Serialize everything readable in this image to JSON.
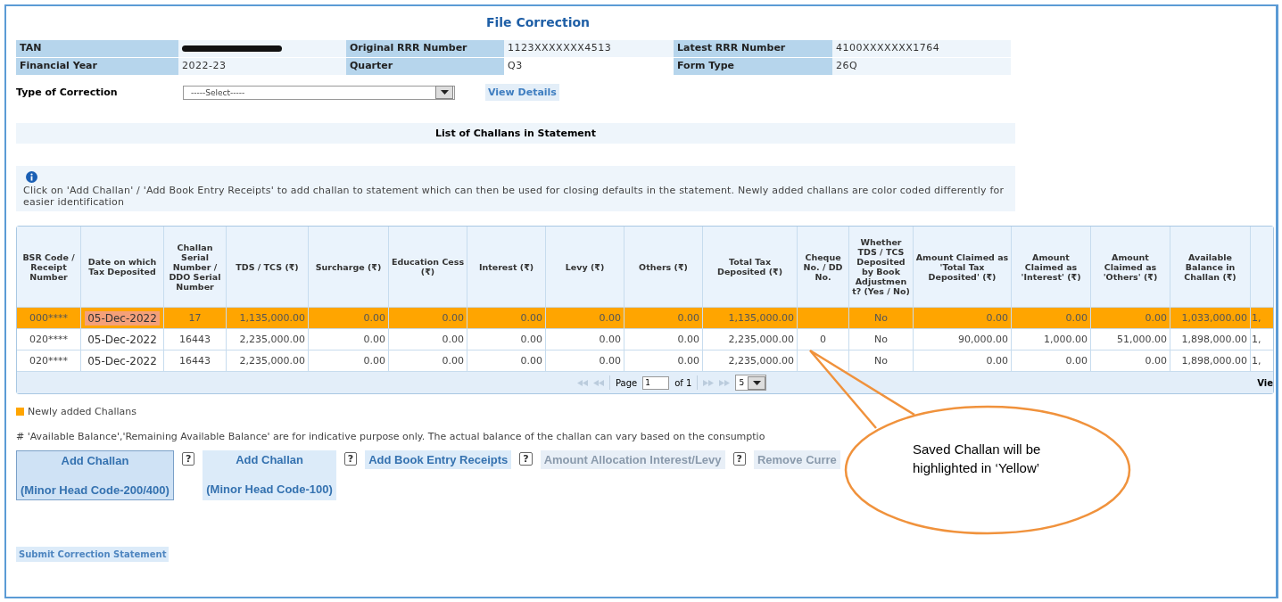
{
  "title": "File Correction",
  "info": [
    {
      "label": "TAN",
      "redacted": true
    },
    {
      "label": "Original RRR Number",
      "value": "1123XXXXXXX4513"
    },
    {
      "label": "Latest RRR Number",
      "value": "4100XXXXXXX1764"
    },
    {
      "label": "Financial Year",
      "value": "2022-23"
    },
    {
      "label": "Quarter",
      "value": "Q3"
    },
    {
      "label": "Form Type",
      "value": "26Q"
    }
  ],
  "correction": {
    "label": "Type of Correction",
    "placeholder": "-----Select-----",
    "button": "View Details"
  },
  "list_heading": "List of Challans in Statement",
  "info_text": "Click on 'Add Challan' / 'Add Book Entry Receipts' to add challan to statement which can then be used for closing defaults in the statement. Newly added challans are color coded differently for easier identification",
  "table": {
    "columns": [
      "BSR Code / Receipt Number",
      "Date on which Tax Deposited",
      "Challan Serial Number / DDO Serial Number",
      "TDS / TCS (₹)",
      "Surcharge (₹)",
      "Education Cess (₹)",
      "Interest (₹)",
      "Levy (₹)",
      "Others (₹)",
      "Total Tax Deposited (₹)",
      "Cheque No. / DD No.",
      "Whether TDS / TCS Deposited by Book Adjustmen t? (Yes / No)",
      "Amount Claimed as 'Total Tax Deposited' (₹)",
      "Amount Claimed as 'Interest' (₹)",
      "Amount Claimed as 'Others' (₹)",
      "Available Balance in Challan (₹)",
      ""
    ],
    "rows": [
      {
        "new": true,
        "cells": [
          "000****",
          "05-Dec-2022",
          "17",
          "1,135,000.00",
          "0.00",
          "0.00",
          "0.00",
          "0.00",
          "0.00",
          "1,135,000.00",
          "",
          "No",
          "0.00",
          "0.00",
          "0.00",
          "1,033,000.00",
          "1,"
        ]
      },
      {
        "new": false,
        "cells": [
          "020****",
          "05-Dec-2022",
          "16443",
          "2,235,000.00",
          "0.00",
          "0.00",
          "0.00",
          "0.00",
          "0.00",
          "2,235,000.00",
          "0",
          "No",
          "90,000.00",
          "1,000.00",
          "51,000.00",
          "1,898,000.00",
          "1,"
        ]
      },
      {
        "new": false,
        "cells": [
          "020****",
          "05-Dec-2022",
          "16443",
          "2,235,000.00",
          "0.00",
          "0.00",
          "0.00",
          "0.00",
          "0.00",
          "2,235,000.00",
          "",
          "No",
          "0.00",
          "0.00",
          "0.00",
          "1,898,000.00",
          "1,"
        ]
      }
    ],
    "pager": {
      "page_label": "Page",
      "page": "1",
      "of": "of 1",
      "page_size": "5",
      "view": "Vie"
    }
  },
  "legend": {
    "label": "Newly added Challans",
    "color": "#ffa500"
  },
  "note": "# 'Available Balance','Remaining Available Balance' are for indicative purpose only. The actual balance of the challan can vary based on the consumptio",
  "buttons": [
    {
      "label": "Add Challan",
      "sublabel": "(Minor Head Code-200/400)",
      "selected": true,
      "disabled": false,
      "help": "?"
    },
    {
      "label": "Add Challan",
      "sublabel": "(Minor Head Code-100)",
      "selected": false,
      "disabled": false,
      "help": "?"
    },
    {
      "label": "Add Book Entry Receipts",
      "selected": false,
      "disabled": false,
      "help": "?"
    },
    {
      "label": "Amount Allocation Interest/Levy",
      "selected": false,
      "disabled": true,
      "help": "?"
    },
    {
      "label": "Remove Curre",
      "selected": false,
      "disabled": true
    }
  ],
  "submit": "Submit Correction Statement",
  "callout": {
    "lines": [
      "Saved Challan will be",
      "highlighted in ‘Yellow’"
    ]
  }
}
